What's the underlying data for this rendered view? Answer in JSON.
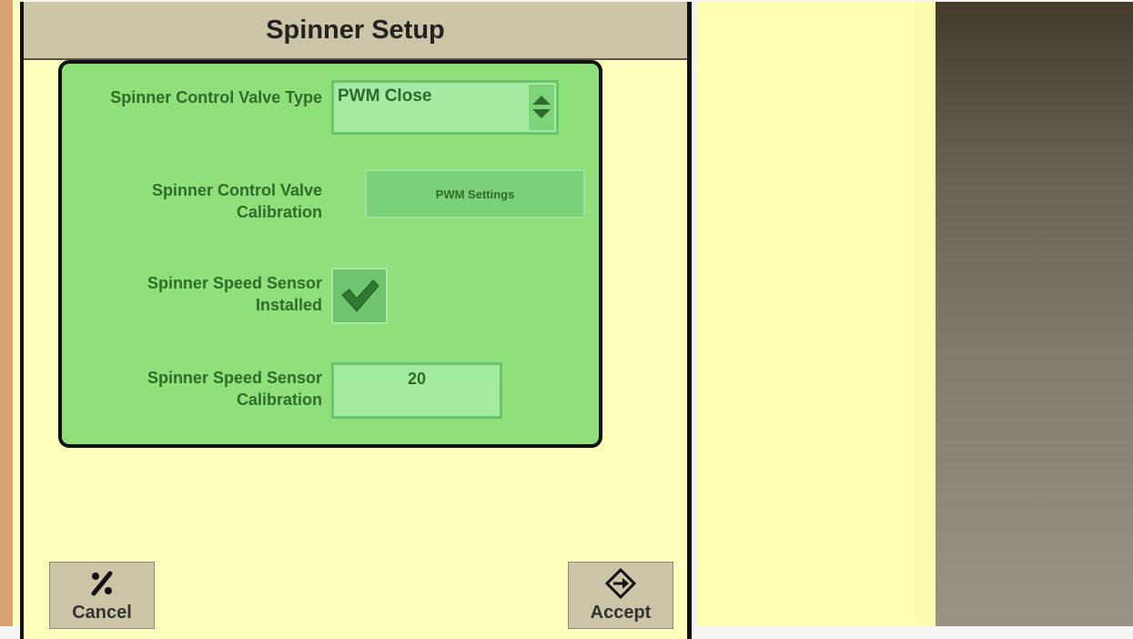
{
  "dialog": {
    "title": "Spinner Setup"
  },
  "fields": {
    "valve_type": {
      "label": "Spinner Control Valve Type",
      "value": "PWM Close"
    },
    "valve_calibration": {
      "label_line1": "Spinner Control Valve",
      "label_line2": "Calibration",
      "button_label": "PWM Settings"
    },
    "speed_sensor_installed": {
      "label_line1": "Spinner Speed Sensor",
      "label_line2": "Installed",
      "checked": true
    },
    "speed_sensor_calibration": {
      "label_line1": "Spinner Speed Sensor",
      "label_line2": "Calibration",
      "value": "20"
    }
  },
  "footer": {
    "cancel_label": "Cancel",
    "accept_label": "Accept"
  },
  "icons": {
    "select_spinner": "up-down-arrows-icon",
    "checkbox": "checkmark-icon",
    "cancel": "percent-cancel-icon",
    "accept": "arrow-diamond-icon"
  },
  "colors": {
    "panel_green": "#8fe07b",
    "text_green": "#2f6b2a",
    "dialog_bg": "#ffffbe",
    "header_bg": "#cbc4a6"
  }
}
